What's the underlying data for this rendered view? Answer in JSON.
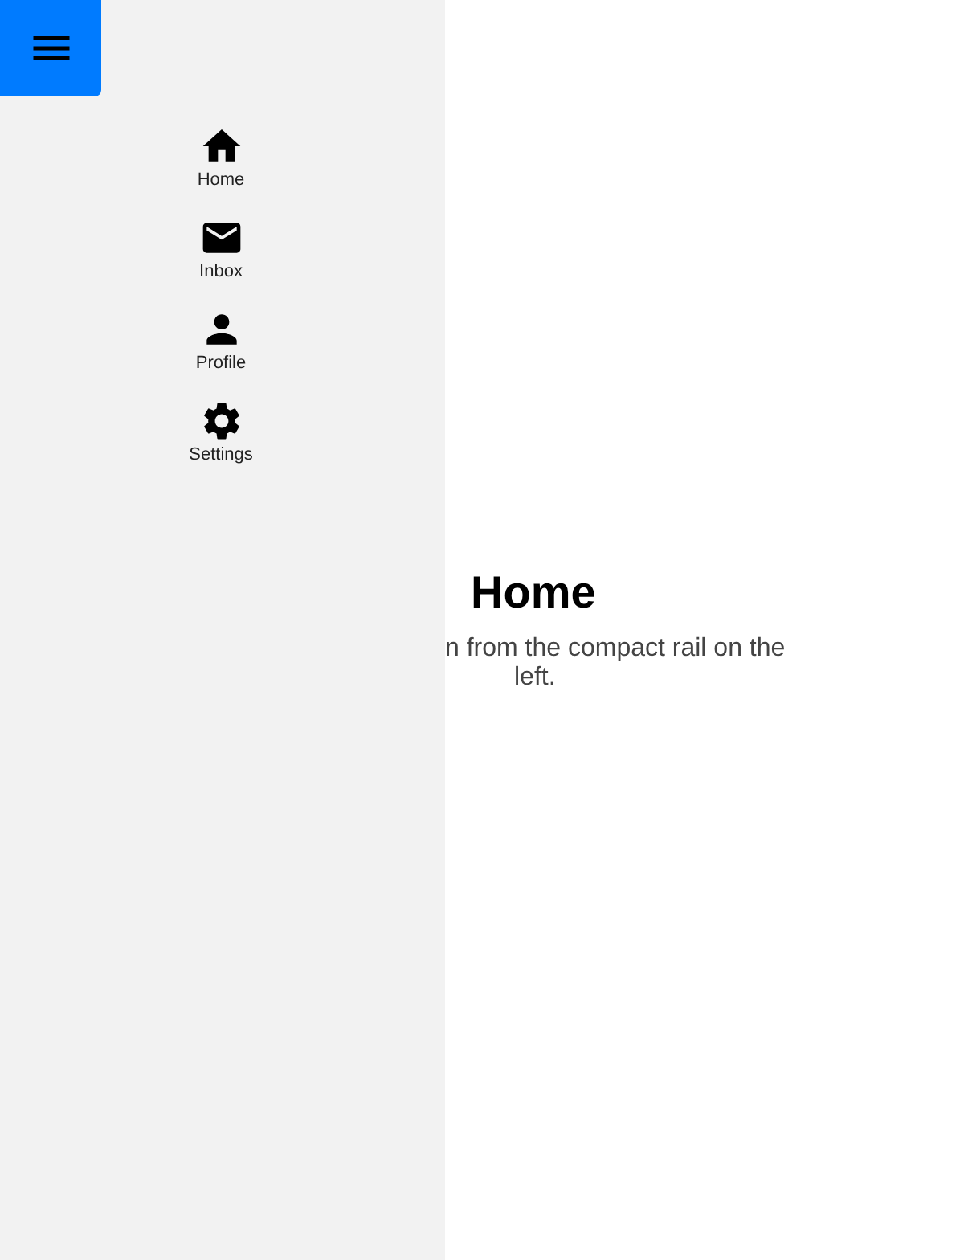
{
  "rail": {
    "items": [
      {
        "label": "Home"
      },
      {
        "label": "Inbox"
      },
      {
        "label": "Profile"
      },
      {
        "label": "Settings"
      }
    ]
  },
  "main": {
    "heading": "Home",
    "text_lines": [
      "n from the compact rail on the",
      "left."
    ]
  }
}
